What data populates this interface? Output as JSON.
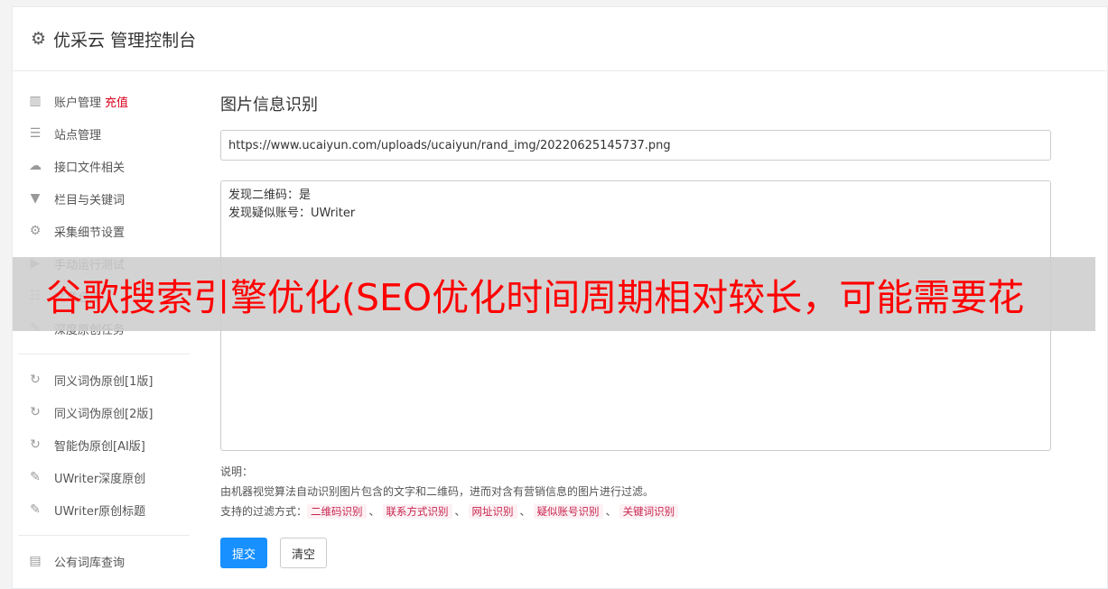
{
  "header": {
    "title": "优采云 管理控制台"
  },
  "sidebar": {
    "group1": [
      {
        "icon": "bar-chart-icon",
        "glyph": "▥",
        "label": "账户管理",
        "extra": "充值"
      },
      {
        "icon": "server-icon",
        "glyph": "☰",
        "label": "站点管理"
      },
      {
        "icon": "cloud-upload-icon",
        "glyph": "☁",
        "label": "接口文件相关"
      },
      {
        "icon": "filter-icon",
        "glyph": "▼",
        "label": "栏目与关键词"
      },
      {
        "icon": "gears-icon",
        "glyph": "⚙",
        "label": "采集细节设置"
      },
      {
        "icon": "play-circle-icon",
        "glyph": "▶",
        "label": "手动运行测试"
      },
      {
        "icon": "database-icon",
        "glyph": "☷",
        "label": "文章仓库"
      },
      {
        "icon": "edit-icon",
        "glyph": "✎",
        "label": "深度原创任务"
      }
    ],
    "group2": [
      {
        "icon": "refresh-icon",
        "glyph": "↻",
        "label": "同义词伪原创[1版]"
      },
      {
        "icon": "refresh-icon",
        "glyph": "↻",
        "label": "同义词伪原创[2版]"
      },
      {
        "icon": "refresh-icon",
        "glyph": "↻",
        "label": "智能伪原创[AI版]"
      },
      {
        "icon": "edit-icon",
        "glyph": "✎",
        "label": "UWriter深度原创"
      },
      {
        "icon": "edit-icon",
        "glyph": "✎",
        "label": "UWriter原创标题"
      }
    ],
    "group3": [
      {
        "icon": "book-icon",
        "glyph": "▤",
        "label": "公有词库查询"
      }
    ]
  },
  "main": {
    "title": "图片信息识别",
    "url_value": "https://www.ucaiyun.com/uploads/ucaiyun/rand_img/20220625145737.png",
    "result_line1": "发现二维码：是",
    "result_line2": "发现疑似账号：UWriter",
    "desc_label": "说明：",
    "desc_text": "由机器视觉算法自动识别图片包含的文字和二维码，进而对含有营销信息的图片进行过滤。",
    "filter_label": "支持的过滤方式：",
    "filter_tags": [
      "二维码识别",
      "联系方式识别",
      "网址识别",
      "疑似账号识别",
      "关键词识别"
    ],
    "submit_label": "提交",
    "clear_label": "清空"
  },
  "overlay": {
    "text": "谷歌搜索引擎优化(SEO优化时间周期相对较长，可能需要花"
  }
}
